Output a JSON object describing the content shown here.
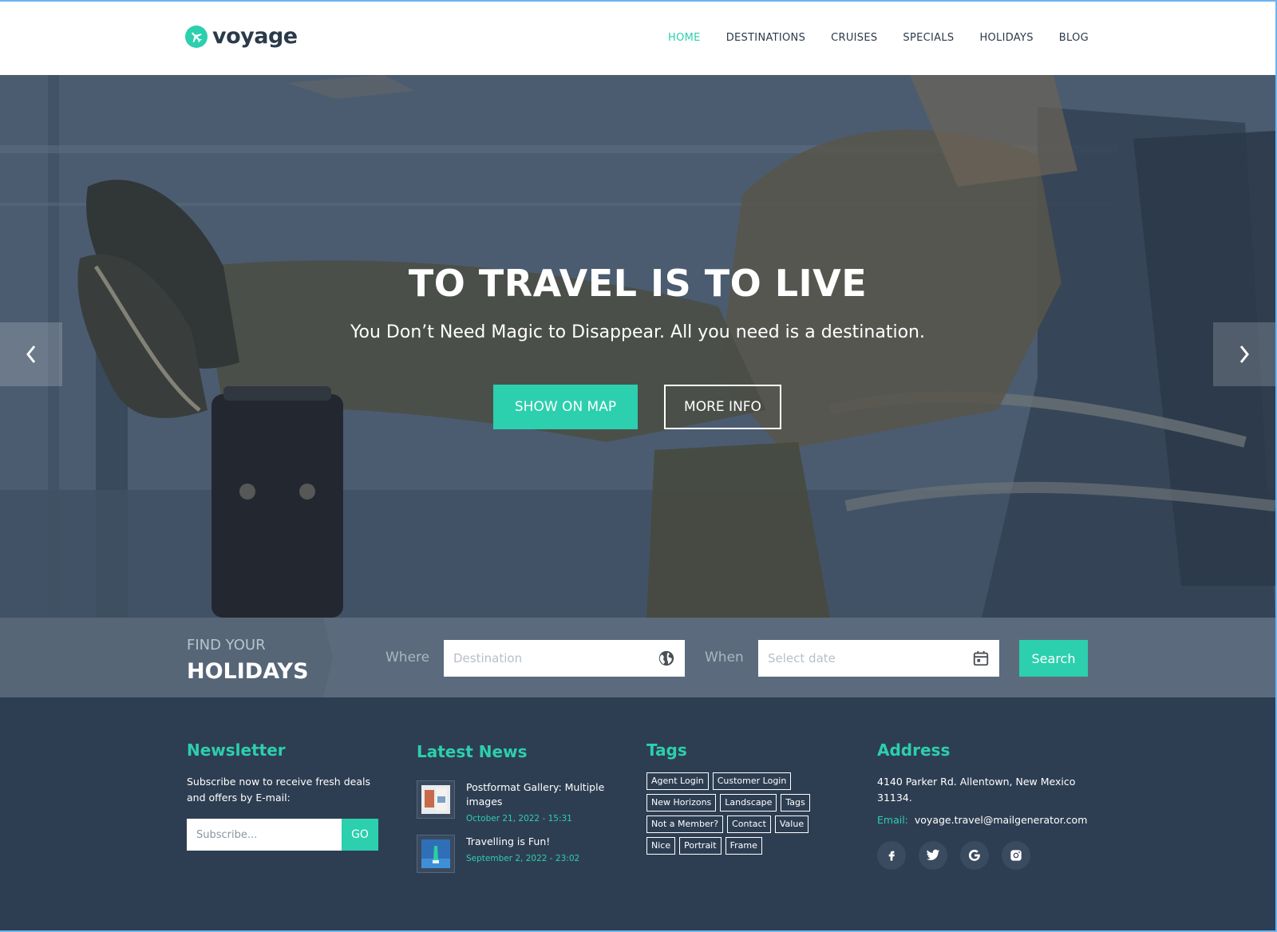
{
  "brand": {
    "name": "voyage",
    "accent": "#2ccfae",
    "dark": "#2e3e52"
  },
  "nav": {
    "items": [
      {
        "label": "HOME",
        "active": true
      },
      {
        "label": "DESTINATIONS",
        "active": false
      },
      {
        "label": "CRUISES",
        "active": false
      },
      {
        "label": "SPECIALS",
        "active": false
      },
      {
        "label": "HOLIDAYS",
        "active": false
      },
      {
        "label": "BLOG",
        "active": false
      }
    ]
  },
  "hero": {
    "title": "TO TRAVEL IS TO LIVE",
    "subtitle": "You Don’t Need Magic to Disappear. All you need is a destination.",
    "primary_button": "SHOW ON MAP",
    "secondary_button": "MORE INFO",
    "prev_icon": "chevron-left-icon",
    "next_icon": "chevron-right-icon"
  },
  "search": {
    "heading_small": "FIND YOUR",
    "heading_big": "HOLIDAYS",
    "where_label": "Where",
    "where_placeholder": "Destination",
    "where_icon": "globe-icon",
    "when_label": "When",
    "when_placeholder": "Select date",
    "when_icon": "calendar-icon",
    "button": "Search"
  },
  "footer": {
    "newsletter": {
      "title": "Newsletter",
      "text": "Subscribe now to receive fresh deals and offers by E-mail:",
      "placeholder": "Subscribe...",
      "button": "GO"
    },
    "news": {
      "title": "Latest News",
      "items": [
        {
          "title": "Postformat Gallery: Multiple images",
          "date": "October 21, 2022 - 15:31"
        },
        {
          "title": "Travelling is Fun!",
          "date": "September 2, 2022 - 23:02"
        }
      ]
    },
    "tags": {
      "title": "Tags",
      "items": [
        "Agent Login",
        "Customer Login",
        "New Horizons",
        "Landscape",
        "Tags",
        "Not a Member?",
        "Contact",
        "Value",
        "Nice",
        "Portrait",
        "Frame"
      ]
    },
    "address": {
      "title": "Address",
      "text": "4140 Parker Rd. Allentown, New Mexico 31134.",
      "email_label": "Email:",
      "email": "voyage.travel@mailgenerator.com",
      "socials": [
        "facebook-icon",
        "twitter-icon",
        "google-icon",
        "instagram-icon"
      ]
    }
  }
}
